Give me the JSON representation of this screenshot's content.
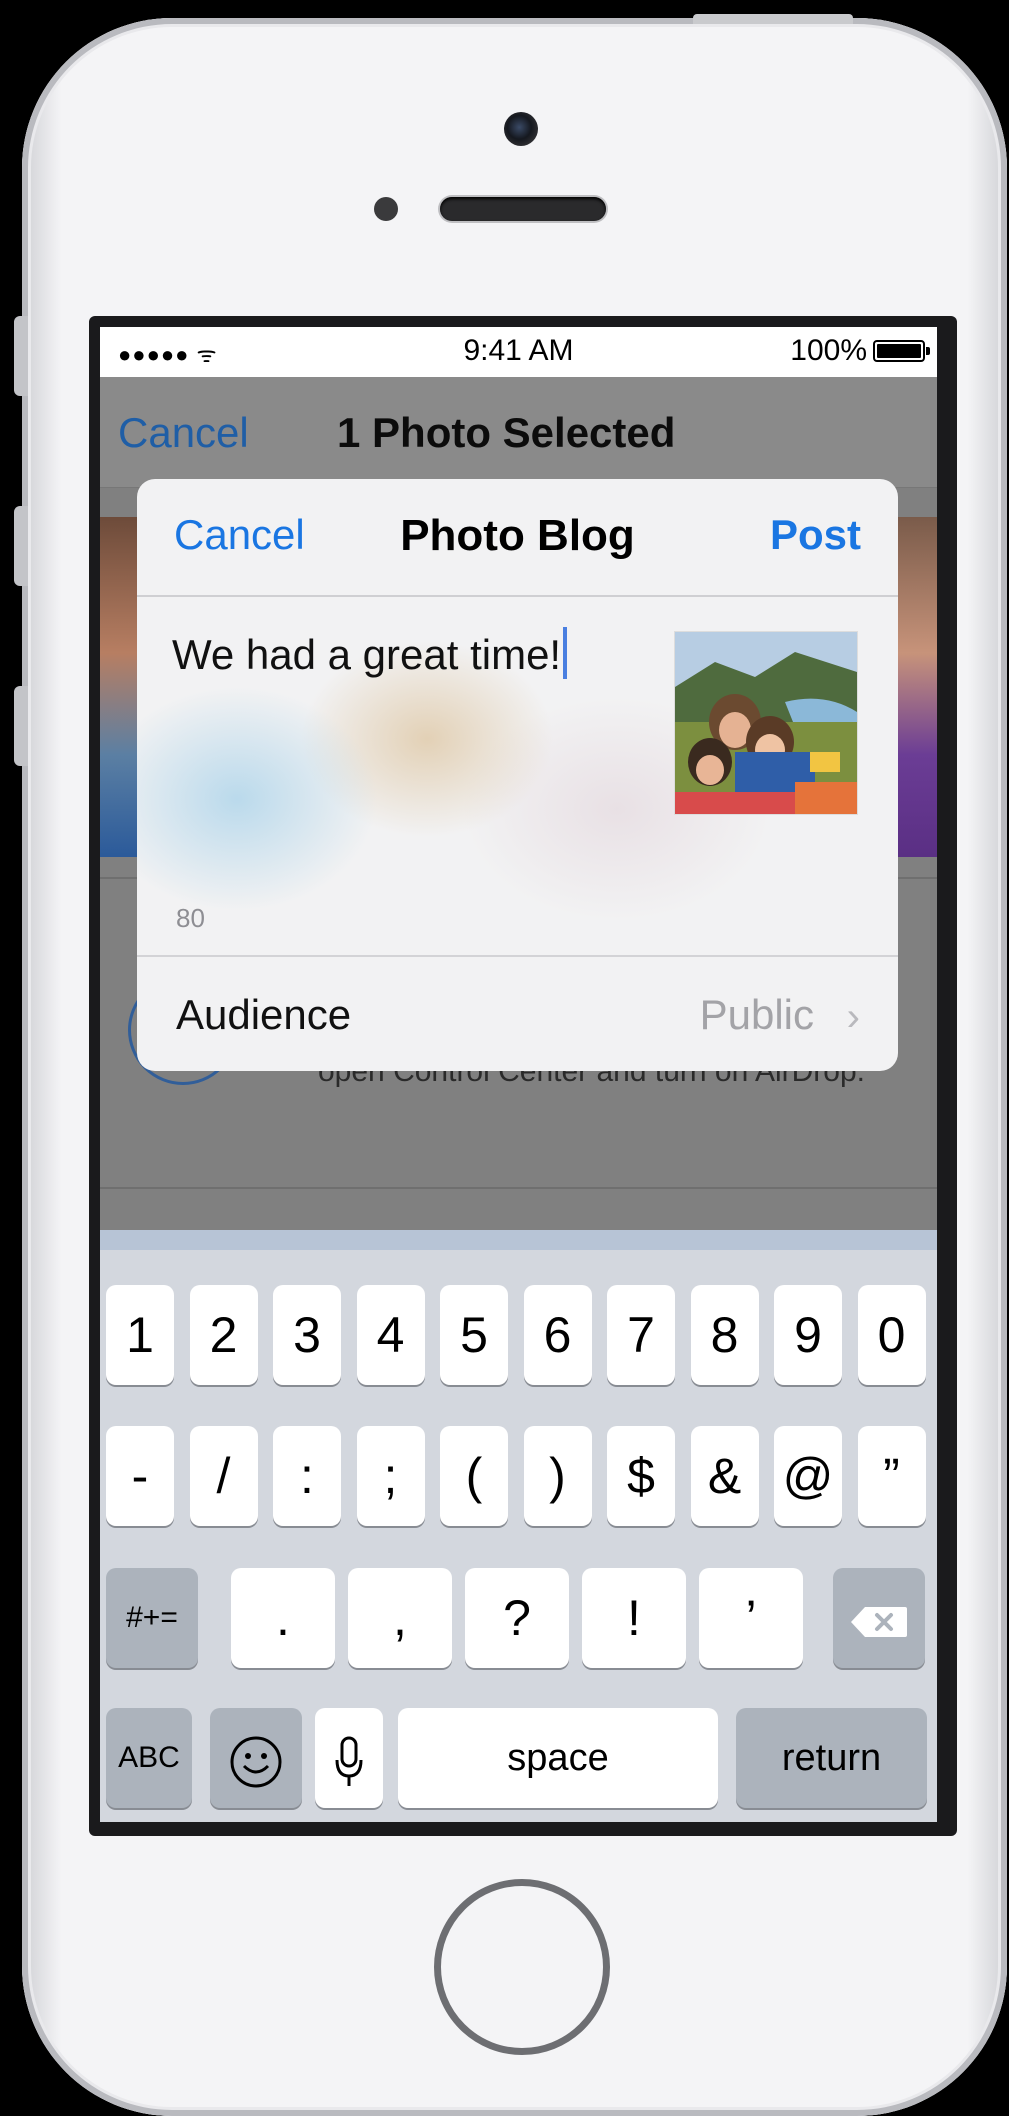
{
  "status_bar": {
    "signal": "●●●●● ᯤ",
    "time": "9:41 AM",
    "battery": "100%"
  },
  "background_view": {
    "cancel": "Cancel",
    "title": "1 Photo Selected",
    "airdrop_hint": "open Control Center and turn on AirDrop."
  },
  "compose_sheet": {
    "cancel": "Cancel",
    "title": "Photo Blog",
    "post": "Post",
    "message": "We had a great time!",
    "char_count": "80",
    "audience_label": "Audience",
    "audience_value": "Public",
    "chevron": "›"
  },
  "keyboard": {
    "row1": [
      "1",
      "2",
      "3",
      "4",
      "5",
      "6",
      "7",
      "8",
      "9",
      "0"
    ],
    "row2": [
      "-",
      "/",
      ":",
      ";",
      "(",
      ")",
      "$",
      "&",
      "@",
      "”"
    ],
    "row3": {
      "shift": "#+=",
      "keys": [
        ".",
        ",",
        "?",
        "!",
        "’"
      ],
      "delete": "⌫"
    },
    "row4": {
      "abc": "ABC",
      "emoji": "☺",
      "mic": "🎙",
      "space": "space",
      "return": "return"
    }
  },
  "colors": {
    "accent_blue": "#1a76e2",
    "keyboard_bg": "#d3d7de",
    "dimmed_bg": "#808080"
  }
}
